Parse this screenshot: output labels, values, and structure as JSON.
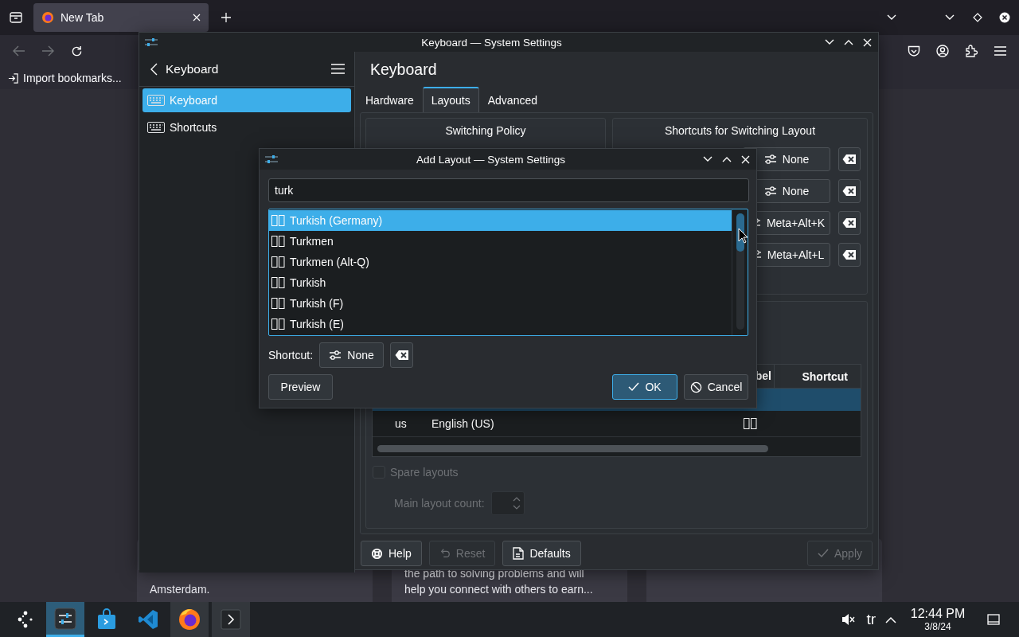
{
  "browser": {
    "tabs": [
      {
        "title": "New Tab",
        "selected": true
      }
    ],
    "bookmarks": [
      {
        "label": "Import bookmarks..."
      }
    ],
    "cards": [
      {
        "kind": "text",
        "text": "Amsterdam."
      },
      {
        "kind": "text",
        "text": "the path to solving problems and will help you connect with others to earn..."
      },
      {
        "kind": "blank"
      }
    ]
  },
  "settings": {
    "title": "Keyboard — System Settings",
    "sidebar": {
      "title": "Keyboard",
      "items": [
        {
          "label": "Keyboard",
          "selected": true
        },
        {
          "label": "Shortcuts",
          "selected": false
        }
      ]
    },
    "page_title": "Keyboard",
    "tabs": [
      {
        "label": "Hardware",
        "selected": false
      },
      {
        "label": "Layouts",
        "selected": true
      },
      {
        "label": "Advanced",
        "selected": false
      }
    ],
    "switching_policy": {
      "title": "Switching Policy"
    },
    "switching_shortcuts": {
      "title": "Shortcuts for Switching Layout",
      "rows": [
        {
          "shortcut": "None"
        },
        {
          "shortcut": "None"
        },
        {
          "shortcut": "Meta+Alt+K"
        },
        {
          "shortcut": "Meta+Alt+L"
        }
      ]
    },
    "layouts_table": {
      "columns": [
        "bel",
        "Shortcut"
      ],
      "rows": [
        {
          "selected": true
        },
        {
          "selected": false,
          "layout": "us",
          "name": "English (US)"
        }
      ]
    },
    "spare_layouts": {
      "label": "Spare layouts",
      "checked": false,
      "disabled": true
    },
    "main_layout_count": {
      "label": "Main layout count:",
      "disabled": true
    },
    "buttons": [
      {
        "label": "Help",
        "kind": "help",
        "disabled": false
      },
      {
        "label": "Reset",
        "kind": "undo",
        "disabled": true
      },
      {
        "label": "Defaults",
        "kind": "document",
        "disabled": false
      }
    ],
    "apply_button": {
      "label": "Apply",
      "disabled": true
    }
  },
  "dialog": {
    "title": "Add Layout — System Settings",
    "search": {
      "value": "turk"
    },
    "results": [
      {
        "label": "Turkish (Germany)",
        "selected": true
      },
      {
        "label": "Turkmen",
        "selected": false
      },
      {
        "label": "Turkmen (Alt-Q)",
        "selected": false
      },
      {
        "label": "Turkish",
        "selected": false
      },
      {
        "label": "Turkish (F)",
        "selected": false
      },
      {
        "label": "Turkish (E)",
        "selected": false
      }
    ],
    "shortcut": {
      "label": "Shortcut:",
      "value": "None"
    },
    "buttons": [
      {
        "label": "Preview",
        "kind": "plain",
        "default": false
      },
      {
        "label": "OK",
        "kind": "check",
        "default": true
      },
      {
        "label": "Cancel",
        "kind": "cancel",
        "default": false
      }
    ]
  },
  "taskbar": {
    "apps": [
      {
        "kind": "settings",
        "active": true,
        "running": true
      },
      {
        "kind": "store",
        "active": false,
        "running": false
      },
      {
        "kind": "code",
        "active": false,
        "running": false
      },
      {
        "kind": "browser",
        "active": false,
        "running": true
      },
      {
        "kind": "terminal",
        "active": false,
        "running": true
      }
    ],
    "keyboard_layout": "tr",
    "time": "12:44 PM",
    "date": "3/8/24"
  }
}
